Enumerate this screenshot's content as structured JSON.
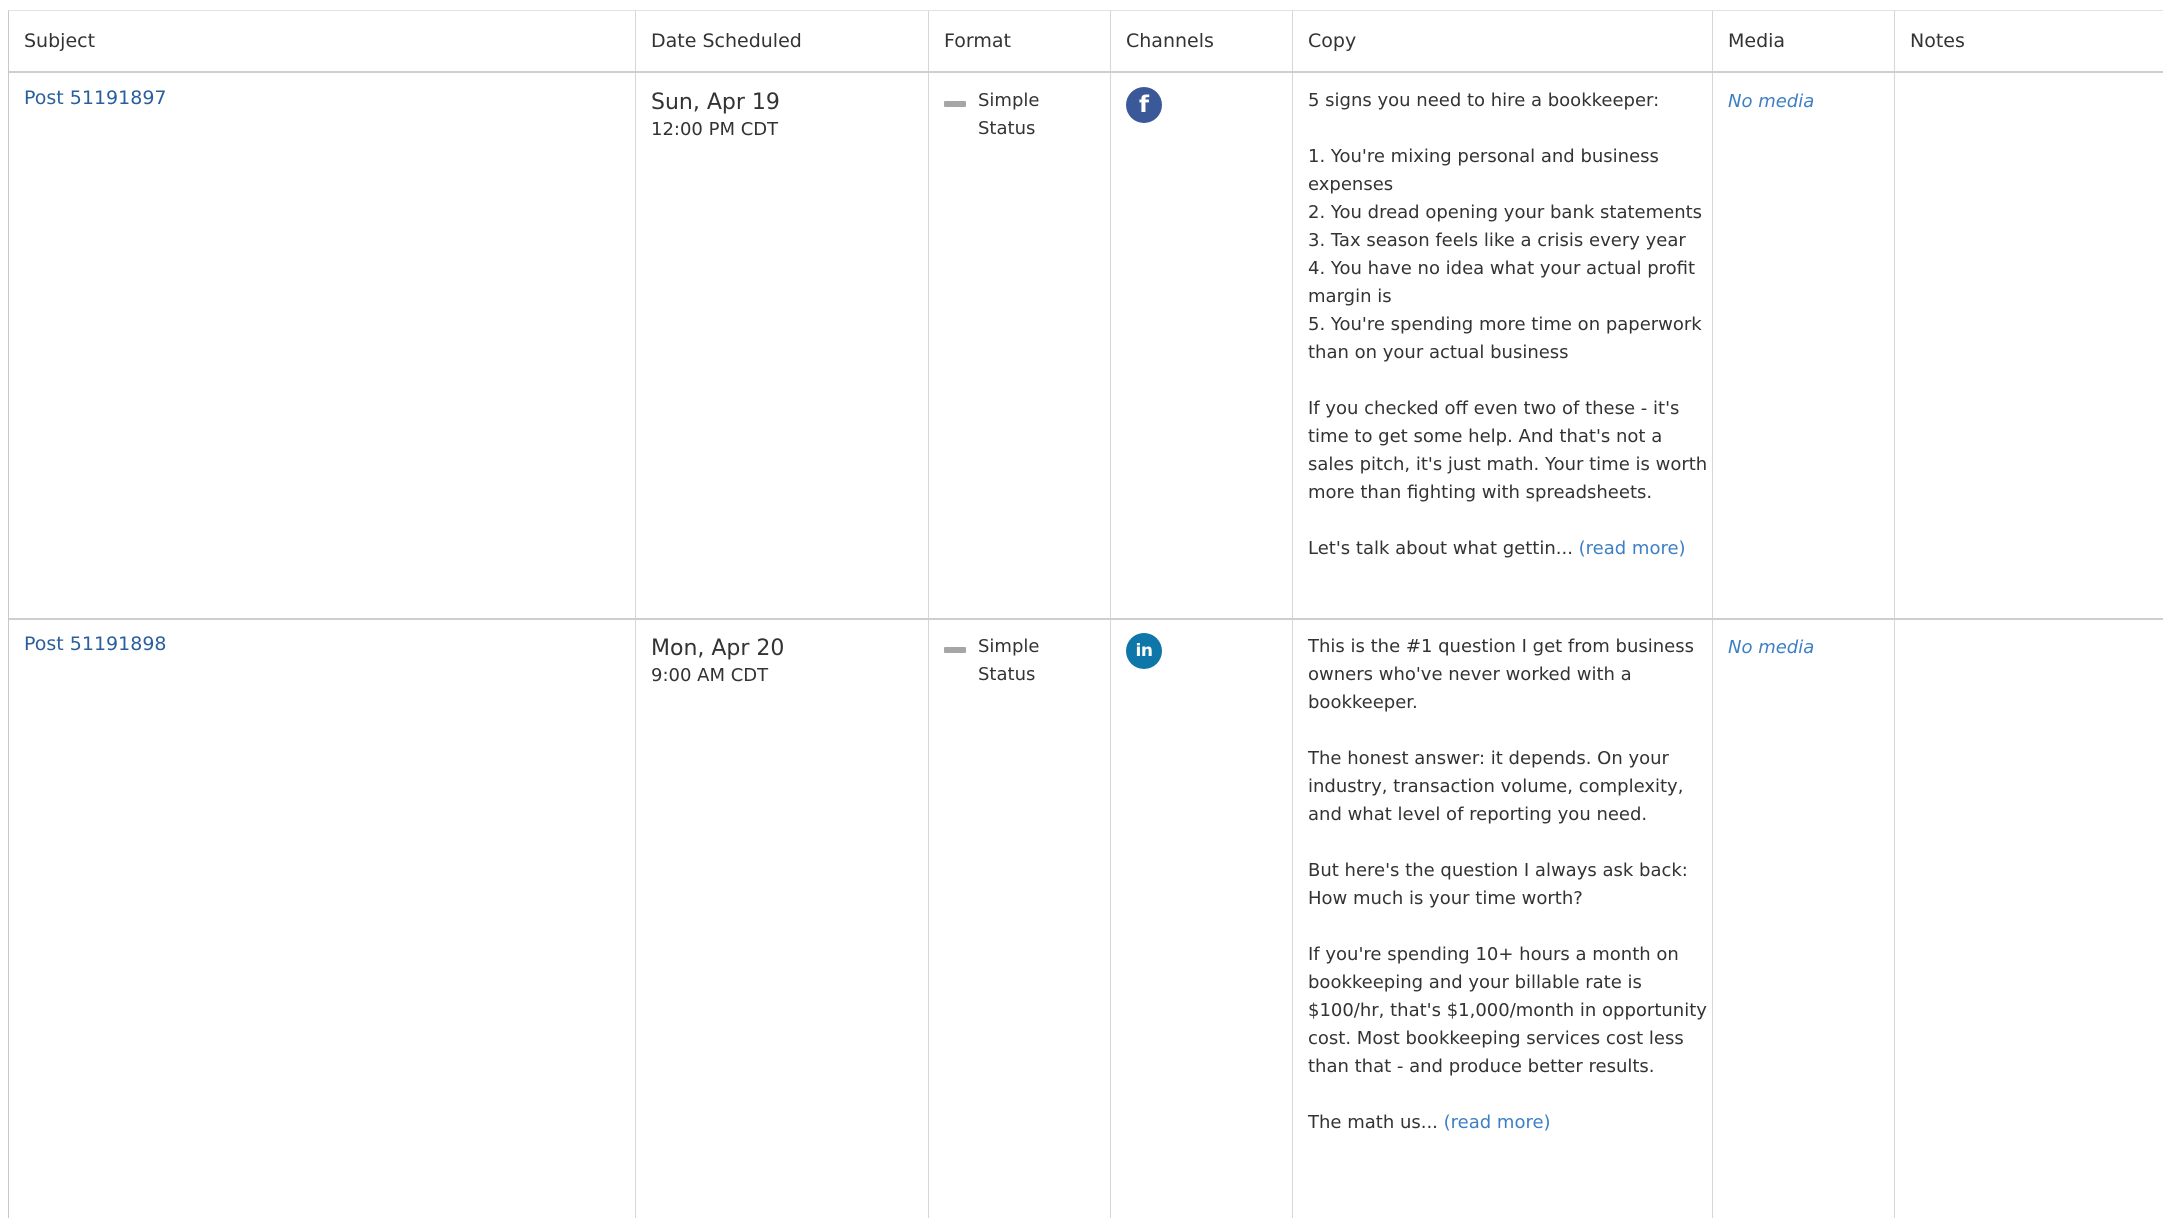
{
  "columns": {
    "subject": "Subject",
    "date": "Date Scheduled",
    "format": "Format",
    "channels": "Channels",
    "copy": "Copy",
    "media": "Media",
    "notes": "Notes"
  },
  "rows": [
    {
      "subject": "Post 51191897",
      "date": "Sun, Apr 19",
      "time": "12:00 PM CDT",
      "format": "Simple Status",
      "channel_icon": "facebook-icon",
      "channel_glyph": "f",
      "copy_paragraphs": [
        "5 signs you need to hire a bookkeeper:",
        "1. You're mixing personal and business expenses\n2. You dread opening your bank statements\n3. Tax season feels like a crisis every year\n4. You have no idea what your actual profit margin is\n5. You're spending more time on paperwork than on your actual business",
        "If you checked off even two of these - it's time to get some help. And that's not a sales pitch, it's just math. Your time is worth more than fighting with spreadsheets."
      ],
      "copy_tail": "Let's talk about what gettin...",
      "read_more": "(read more)",
      "media": "No media",
      "notes": ""
    },
    {
      "subject": "Post 51191898",
      "date": "Mon, Apr 20",
      "time": "9:00 AM CDT",
      "format": "Simple Status",
      "channel_icon": "linkedin-icon",
      "channel_glyph": "in",
      "copy_paragraphs": [
        "This is the #1 question I get from business owners who've never worked with a bookkeeper.",
        "The honest answer: it depends. On your industry, transaction volume, complexity, and what level of reporting you need.",
        "But here's the question I always ask back: How much is your time worth?",
        "If you're spending 10+ hours a month on bookkeeping and your billable rate is $100/hr, that's $1,000/month in opportunity cost. Most bookkeeping services cost less than that - and produce better results."
      ],
      "copy_tail": "The math us...",
      "read_more": "(read more)",
      "media": "No media",
      "notes": ""
    }
  ],
  "colors": {
    "link": "#2a5f9e",
    "read_more": "#3d7fc4",
    "facebook": "#3b5998",
    "linkedin": "#0e76a8"
  }
}
